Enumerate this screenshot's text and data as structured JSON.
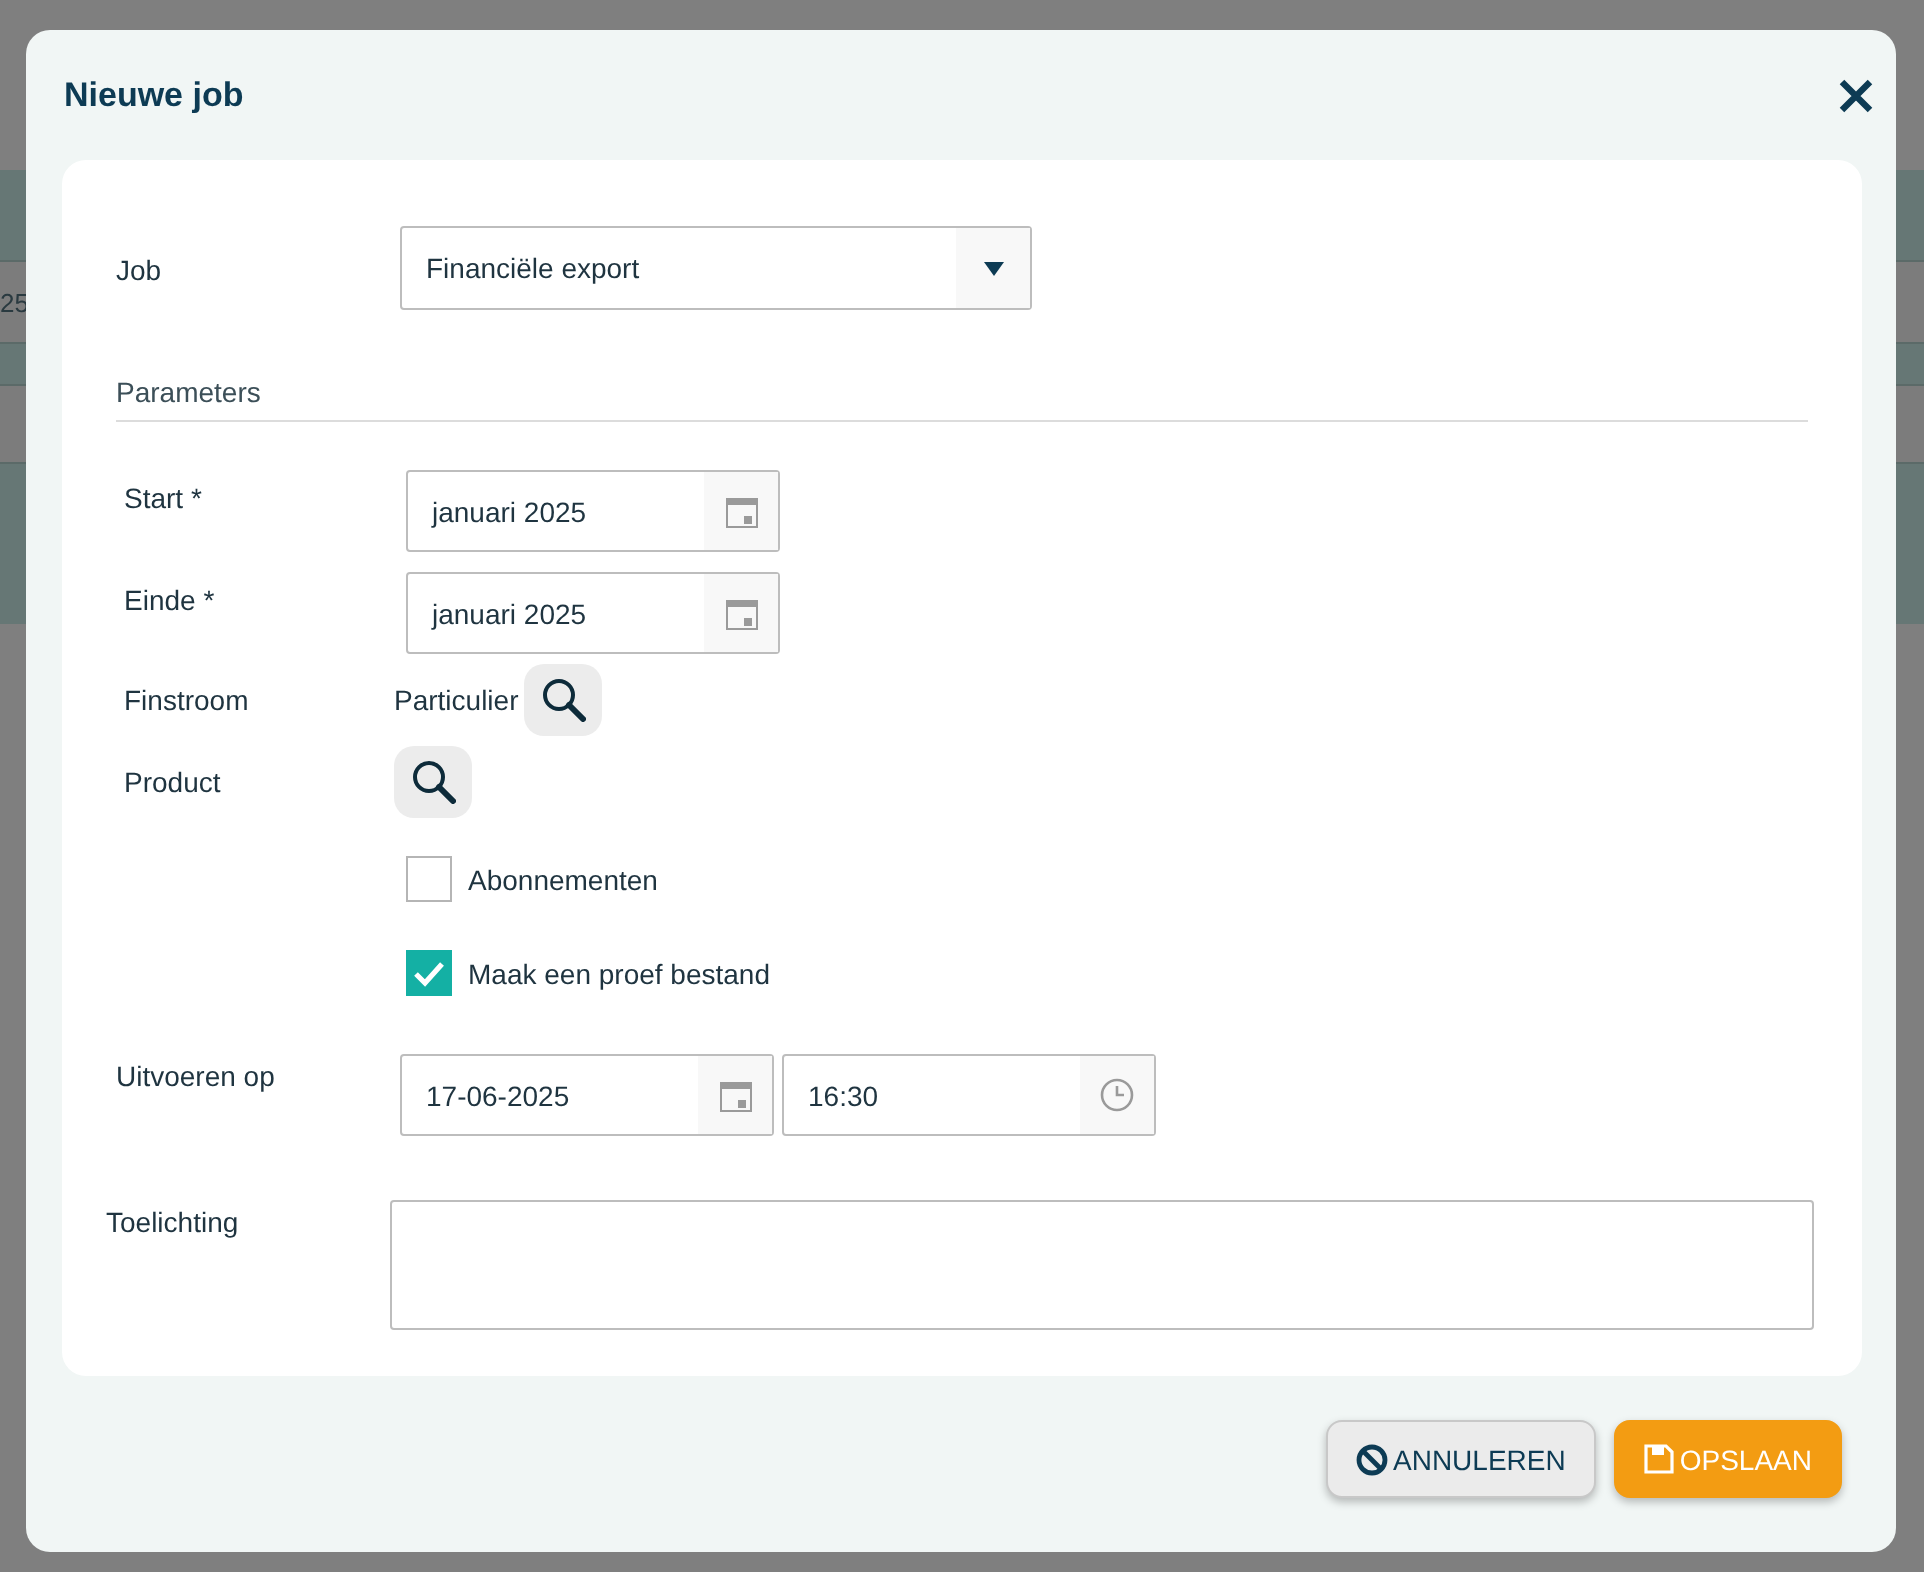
{
  "background": {
    "cell_text": "25"
  },
  "dialog": {
    "title": "Nieuwe job"
  },
  "job": {
    "label": "Job",
    "value": "Financiële export"
  },
  "section": "Parameters",
  "fields": [
    {
      "kind": "date",
      "label": "Start *",
      "value": "januari 2025"
    },
    {
      "kind": "date",
      "label": "Einde *",
      "value": "januari 2025"
    },
    {
      "kind": "lookup",
      "label": "Finstroom",
      "value": "Particulier"
    },
    {
      "kind": "lookup",
      "label": "Product"
    },
    {
      "kind": "checkbox",
      "label": "Abonnementen",
      "checked": false
    },
    {
      "kind": "checkbox",
      "label": "Maak een proef bestand",
      "checked": true
    }
  ],
  "schedule": {
    "label": "Uitvoeren op",
    "date": "17-06-2025",
    "time": "16:30"
  },
  "notes": {
    "label": "Toelichting"
  },
  "buttons": [
    {
      "kind": "cancel",
      "label": "ANNULEREN"
    },
    {
      "kind": "save",
      "label": "OPSLAAN"
    }
  ]
}
